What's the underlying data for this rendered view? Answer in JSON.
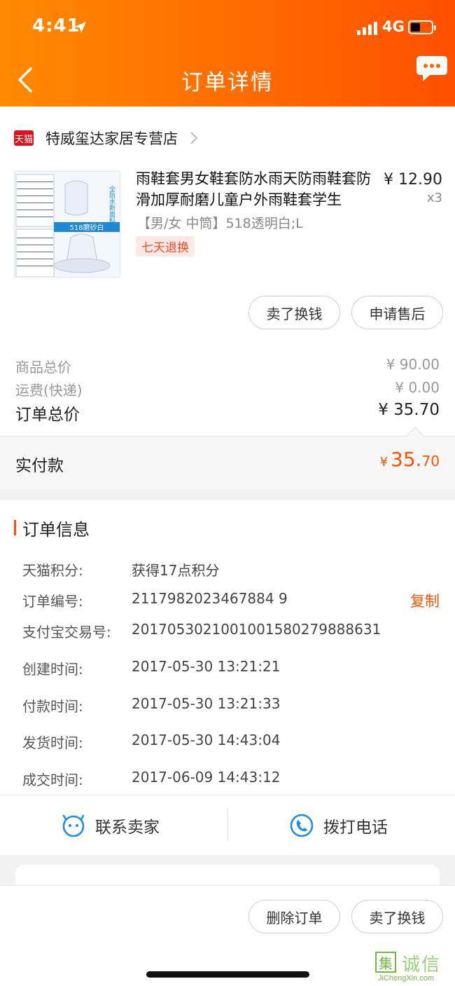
{
  "status_bar": {
    "time": "4:41",
    "network": "4G",
    "battery_level": 0.45
  },
  "nav": {
    "title": "订单详情"
  },
  "shop": {
    "badge": "天猫",
    "name": "特威玺达家居专营店"
  },
  "product": {
    "title": "雨鞋套男女鞋套防水雨天防雨鞋套防滑加厚耐磨儿童户外雨鞋套学生",
    "price": "¥ 12.90",
    "quantity": "x3",
    "sku": "【男/女 中筒】518透明白;L",
    "return_tag": "七天退换",
    "image_badge": "518磨砂白",
    "image_caption": "全防水新面料"
  },
  "item_actions": {
    "sell_label": "卖了换钱",
    "after_sales_label": "申请售后"
  },
  "summary": {
    "goods_label": "商品总价",
    "goods_value": "¥ 90.00",
    "shipping_label": "运费(快递)",
    "shipping_value": "¥ 0.00",
    "total_label": "订单总价",
    "total_value": "¥ 35.70",
    "paid_label": "实付款",
    "paid_currency": "¥",
    "paid_integer": "35.",
    "paid_decimal": "70"
  },
  "order_info": {
    "section_title": "订单信息",
    "copy_label": "复制",
    "rows": [
      {
        "key": "天猫积分:",
        "value": "获得17点积分"
      },
      {
        "key": "订单编号:",
        "value": "2117982023467884 9"
      },
      {
        "key": "支付宝交易号:",
        "value": "2017053021001001580279888631"
      },
      {
        "key": "创建时间:",
        "value": "2017-05-30 13:21:21"
      },
      {
        "key": "付款时间:",
        "value": "2017-05-30 13:21:33"
      },
      {
        "key": "发货时间:",
        "value": "2017-05-30 14:43:04"
      },
      {
        "key": "成交时间:",
        "value": "2017-06-09 14:43:12"
      }
    ]
  },
  "contact": {
    "seller_label": "联系卖家",
    "phone_label": "拨打电话"
  },
  "bottom_actions": {
    "delete_label": "删除订单",
    "sell_label": "卖了换钱"
  },
  "watermark": {
    "glyph": "集",
    "text": "诚信",
    "url": "JiChengXin.com"
  },
  "colors": {
    "brand_orange": "#ff5000",
    "tag_red": "#f24a2b",
    "link_blue": "#1f8ee0"
  }
}
